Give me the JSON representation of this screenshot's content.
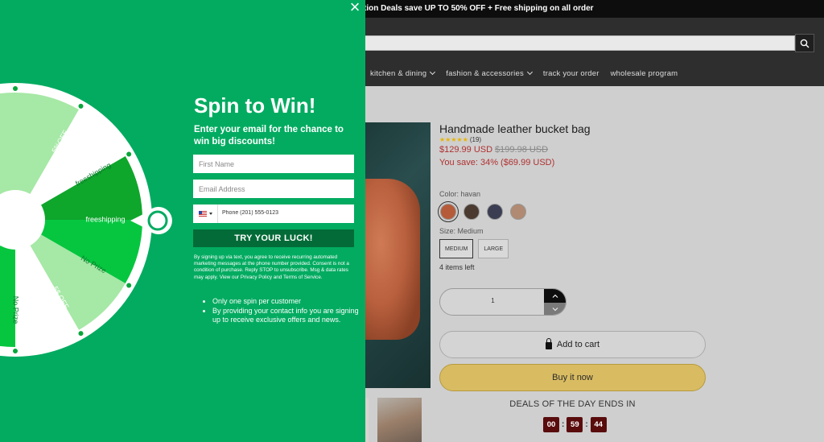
{
  "announcement": "tion Deals save UP TO 50% OFF + Free shipping on all order",
  "nav": {
    "items": [
      {
        "label": "kitchen & dining",
        "dropdown": true
      },
      {
        "label": "fashion & accessories",
        "dropdown": true
      },
      {
        "label": "track your order",
        "dropdown": false
      },
      {
        "label": "wholesale program",
        "dropdown": false
      }
    ]
  },
  "product": {
    "title": "Handmade leather bucket bag",
    "stars": "★★★★★",
    "review_count": "(19)",
    "price": "$129.99 USD",
    "compare_price": "$199.98 USD",
    "savings": "You save: 34% ($69.99 USD)",
    "color_label": "Color: havan",
    "swatch_colors": [
      "#b55b3a",
      "#4a3a30",
      "#3b3e52",
      "#b08a72"
    ],
    "size_label": "Size: Medium",
    "sizes": [
      "MEDIUM",
      "LARGE"
    ],
    "stock": "4 items left",
    "quantity": "1",
    "add_to_cart": "Add to cart",
    "buy_now": "Buy it now",
    "deals_label": "DEALS OF THE DAY ENDS IN",
    "timer": {
      "hours": "00",
      "minutes": "59",
      "seconds": "44"
    }
  },
  "popup": {
    "title": "Spin to Win!",
    "subtitle": "Enter your email for the chance to win big discounts!",
    "first_name_placeholder": "First Name",
    "email_placeholder": "Email Address",
    "phone_placeholder": "Phone (201) 555-0123",
    "submit_label": "TRY YOUR LUCK!",
    "legal": "By signing up via text, you agree to receive recurring automated marketing messages at the phone number provided. Consent is not a condition of purchase. Reply STOP to unsubscribe. Msg & data rates may apply. View our Privacy Policy and Terms of Service.",
    "bullets": [
      "Only one spin per customer",
      "By providing your contact info you are signing up to receive exclusive offers and news."
    ],
    "wheel_segments": [
      "5%OFF",
      "freeshipping",
      "freeshipping",
      "No Prize",
      "5$ OFF",
      "No Prize"
    ],
    "colors": {
      "background": "#02ab60",
      "submit": "#036b37",
      "segment_dark": "#06c63f",
      "segment_mid": "#0fa62c",
      "segment_light": "#a6e8a6"
    }
  }
}
